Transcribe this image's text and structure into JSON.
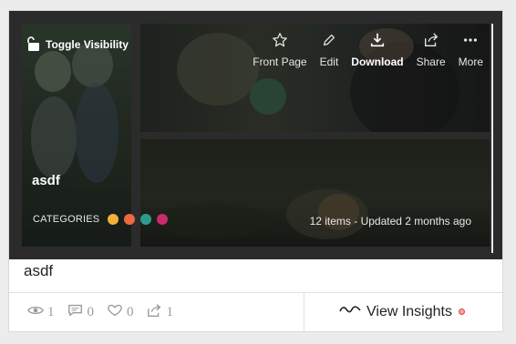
{
  "cover": {
    "toggle_label": "Toggle Visibility",
    "actions": [
      {
        "label": "Front Page",
        "icon": "star-icon"
      },
      {
        "label": "Edit",
        "icon": "pencil-icon"
      },
      {
        "label": "Download",
        "icon": "download-icon"
      },
      {
        "label": "Share",
        "icon": "share-icon"
      },
      {
        "label": "More",
        "icon": "more-icon"
      }
    ],
    "collection_title": "asdf",
    "categories_label": "CATEGORIES",
    "category_colors": [
      "#f2b03a",
      "#ec6a3e",
      "#2c9c8f",
      "#c92b6c"
    ],
    "updated_text": "12 items - Updated 2 months ago"
  },
  "card": {
    "name": "asdf",
    "stats": {
      "views": "1",
      "comments": "0",
      "likes": "0",
      "shares": "1"
    },
    "insights_label": "View Insights",
    "insights_dot_color": "#e2463c"
  }
}
